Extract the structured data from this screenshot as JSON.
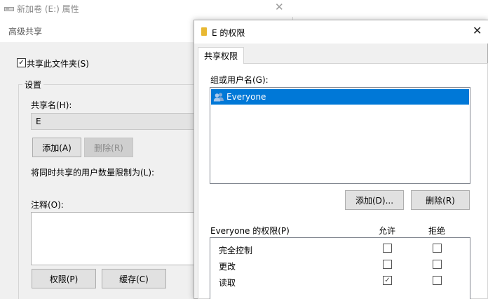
{
  "background_window": {
    "title": "新加卷 (E:) 属性",
    "close_glyph": "✕"
  },
  "advanced_sharing": {
    "title": "高级共享",
    "share_this_folder": {
      "label": "共享此文件夹(S)",
      "checked": true
    },
    "settings_legend": "设置",
    "share_name_label": "共享名(H):",
    "share_name_value": "E",
    "add_button": "添加(A)",
    "remove_button": "删除(R)",
    "user_limit_label": "将同时共享的用户数量限制为(L):",
    "comment_label": "注释(O):",
    "permissions_button": "权限(P)",
    "caching_button": "缓存(C)"
  },
  "permissions_dialog": {
    "title": "E 的权限",
    "close_glyph": "✕",
    "tab_label": "共享权限",
    "group_users_label": "组或用户名(G):",
    "users": [
      {
        "name": "Everyone",
        "icon": "users-group-icon",
        "selected": true
      }
    ],
    "add_button": "添加(D)...",
    "remove_button": "删除(R)",
    "permissions_for_label": "Everyone 的权限(P)",
    "allow_header": "允许",
    "deny_header": "拒绝",
    "permissions": [
      {
        "name": "完全控制",
        "allow": false,
        "deny": false
      },
      {
        "name": "更改",
        "allow": false,
        "deny": false
      },
      {
        "name": "读取",
        "allow": true,
        "deny": false
      }
    ]
  },
  "colors": {
    "selection": "#0078d7",
    "dialog_bg": "#f0f0f0",
    "folder_icon": "#e8b832"
  }
}
